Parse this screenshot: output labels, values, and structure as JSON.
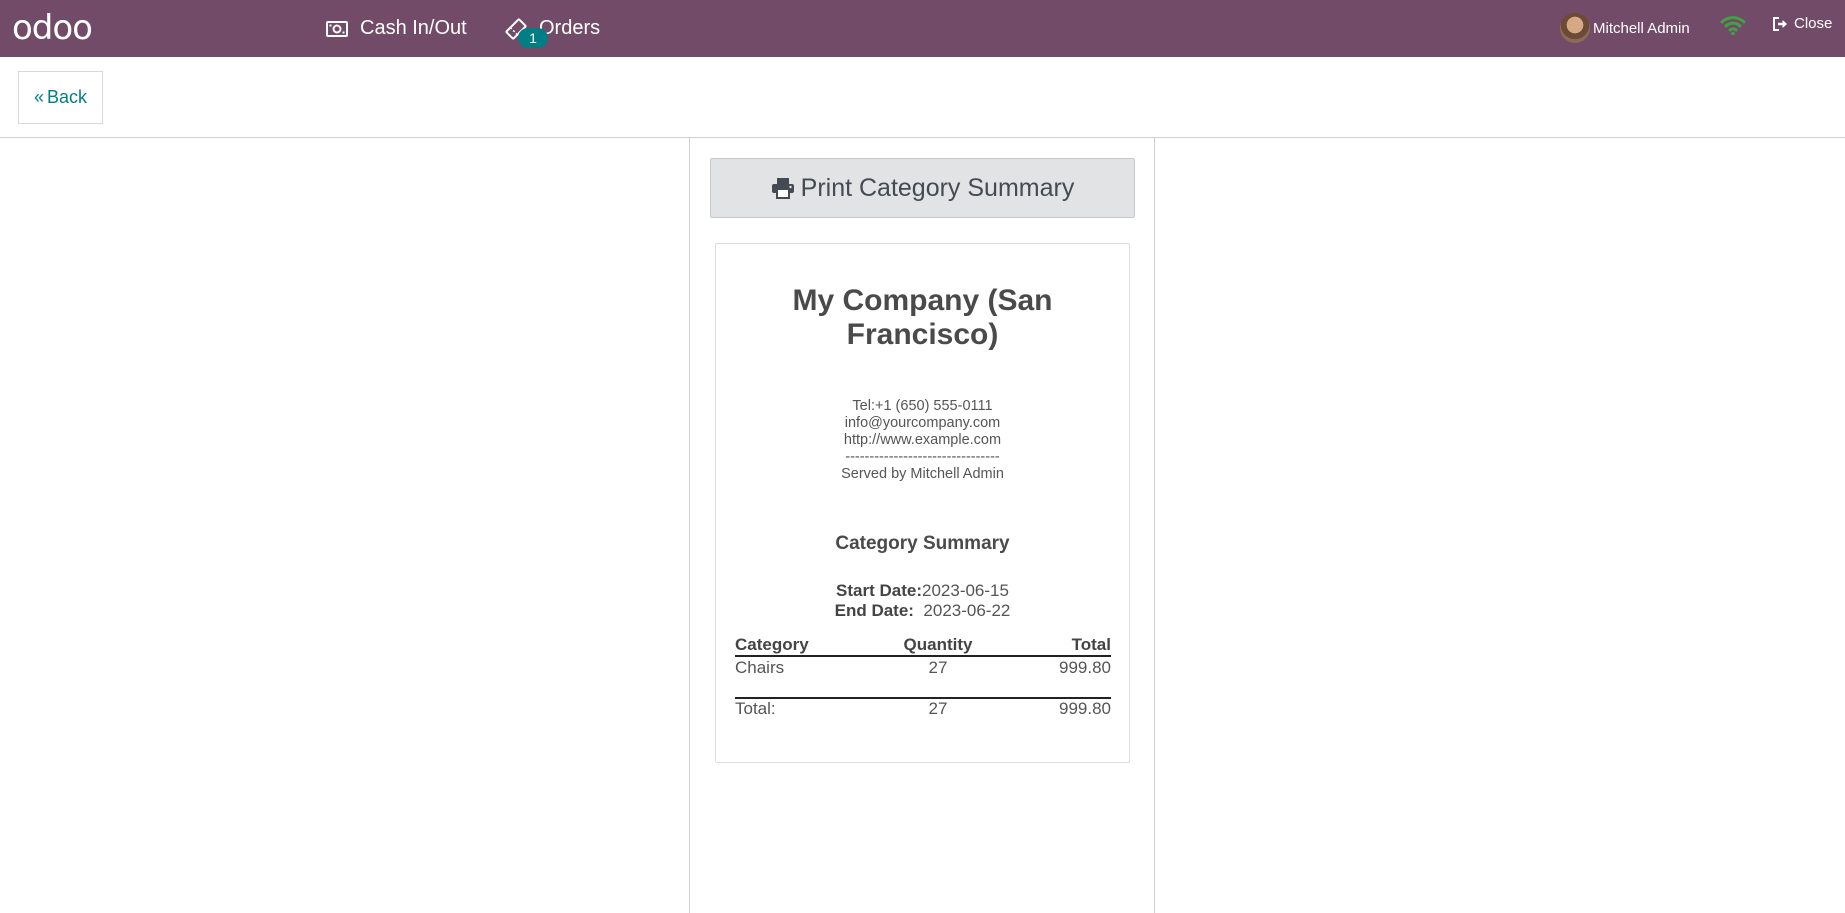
{
  "brand": {
    "logo_text": "odoo"
  },
  "nav": {
    "cash_label": "Cash In/Out",
    "orders_label": "Orders",
    "orders_badge": "1"
  },
  "user": {
    "name": "Mitchell Admin"
  },
  "close_label": "Close",
  "back_label": "Back",
  "print_label": "Print Category Summary",
  "receipt": {
    "company_line1": "My Company (San",
    "company_line2": "Francisco)",
    "tel": "Tel:+1 (650) 555-0111",
    "email": "info@yourcompany.com",
    "website": "http://www.example.com",
    "separator": "--------------------------------",
    "served_by": "Served by Mitchell Admin",
    "title": "Category Summary",
    "start_date_label": "Start Date:",
    "start_date": "2023-06-15",
    "end_date_label": "End Date:",
    "end_date": "2023-06-22",
    "columns": [
      "Category",
      "Quantity",
      "Total"
    ],
    "rows": [
      {
        "category": "Chairs",
        "quantity": "27",
        "total": "999.80"
      }
    ],
    "total_label": "Total:",
    "total_quantity": "27",
    "total_amount": "999.80"
  },
  "colors": {
    "topbar": "#714b67",
    "accent": "#017e84",
    "wifi": "#43a047"
  },
  "icons": [
    "money-icon",
    "orders-ticket-icon",
    "wifi-icon",
    "sign-out-icon",
    "print-icon",
    "angle-double-left-icon"
  ]
}
